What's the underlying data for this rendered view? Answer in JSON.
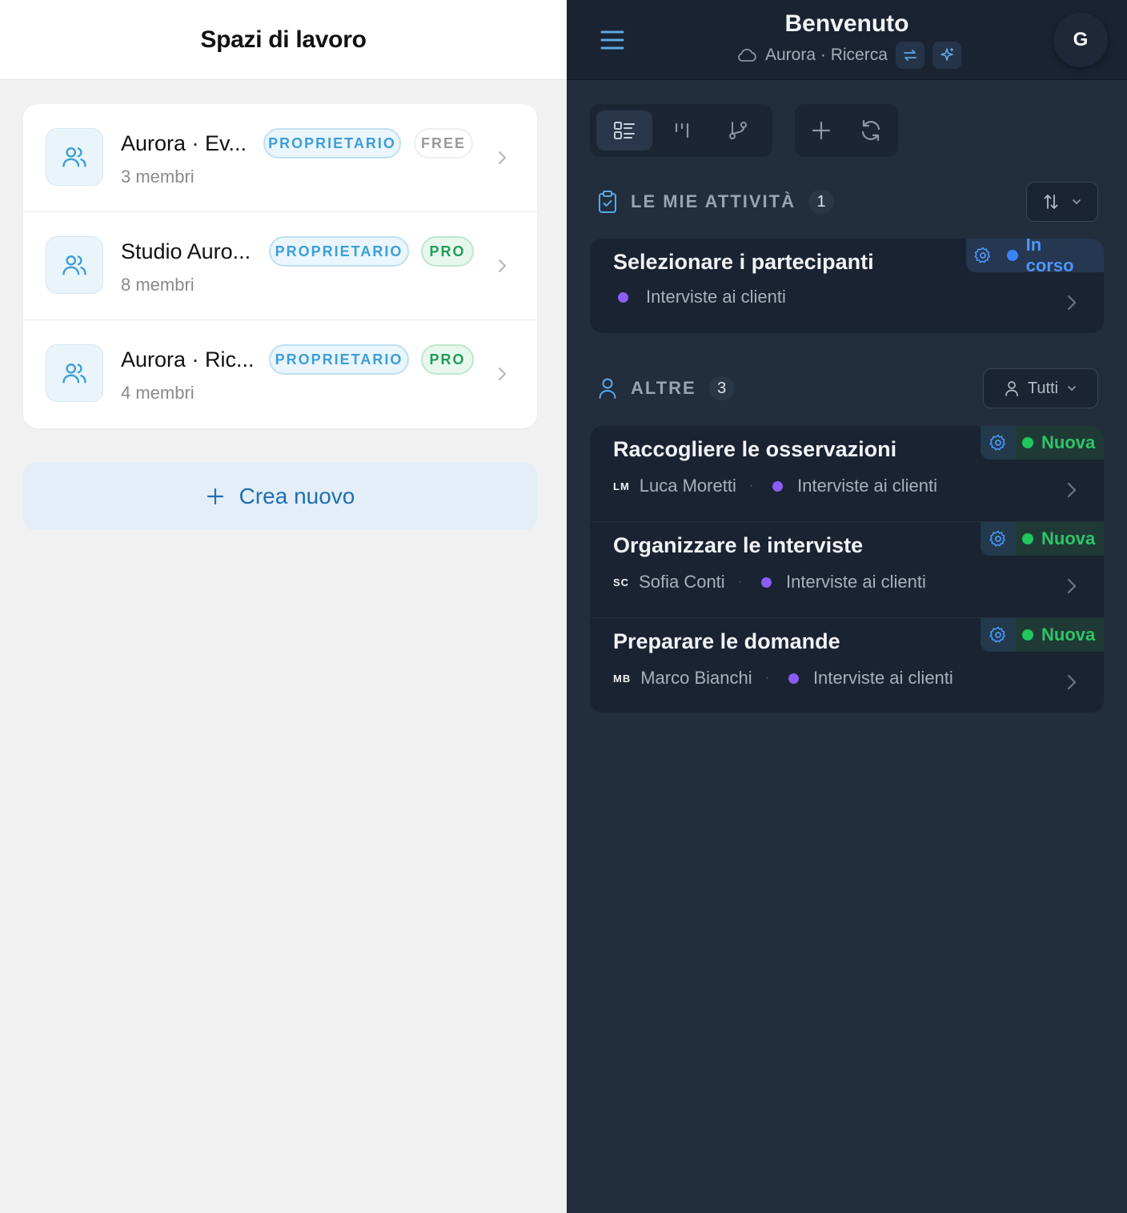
{
  "workspaces_panel": {
    "title": "Spazi di lavoro",
    "items": [
      {
        "name": "Aurora · Ev...",
        "members": "3 membri",
        "role": "PROPRIETARIO",
        "plan": "FREE",
        "plan_kind": "free"
      },
      {
        "name": "Studio Auro...",
        "members": "8 membri",
        "role": "PROPRIETARIO",
        "plan": "PRO",
        "plan_kind": "pro"
      },
      {
        "name": "Aurora · Ric...",
        "members": "4 membri",
        "role": "PROPRIETARIO",
        "plan": "PRO",
        "plan_kind": "pro"
      }
    ],
    "create_label": "Crea nuovo"
  },
  "header": {
    "title": "Benvenuto",
    "workspace": "Aurora · Ricerca",
    "avatar_initial": "G"
  },
  "icons": {
    "menu": "hamburger-icon",
    "cloud": "cloud-icon",
    "switch": "switch-arrows-icon",
    "sparkle": "sparkle-icon",
    "views": [
      "list-view-icon",
      "board-view-icon",
      "flow-view-icon"
    ],
    "add": "plus-icon",
    "refresh": "refresh-icon"
  },
  "my_tasks": {
    "label": "LE MIE ATTIVITÀ",
    "count": "1",
    "items": [
      {
        "title": "Selezionare i partecipanti",
        "project": "Interviste ai clienti",
        "status": "In corso",
        "status_kind": "blue"
      }
    ]
  },
  "others": {
    "label": "ALTRE",
    "count": "3",
    "filter_label": "Tutti",
    "items": [
      {
        "title": "Raccogliere le osservazioni",
        "initials": "LM",
        "assignee": "Luca Moretti",
        "separator": "·",
        "project": "Interviste ai clienti",
        "status": "Nuova",
        "status_kind": "green"
      },
      {
        "title": "Organizzare le interviste",
        "initials": "SC",
        "assignee": "Sofia Conti",
        "separator": "·",
        "project": "Interviste ai clienti",
        "status": "Nuova",
        "status_kind": "green"
      },
      {
        "title": "Preparare le domande",
        "initials": "MB",
        "assignee": "Marco Bianchi",
        "separator": "·",
        "project": "Interviste ai clienti",
        "status": "Nuova",
        "status_kind": "green"
      }
    ]
  },
  "colors": {
    "accent_blue": "#3ba0d6",
    "status_blue": "#3b82f6",
    "status_green": "#22c55e",
    "project_purple": "#8b5cf6",
    "dark_bg": "#222d3e"
  }
}
